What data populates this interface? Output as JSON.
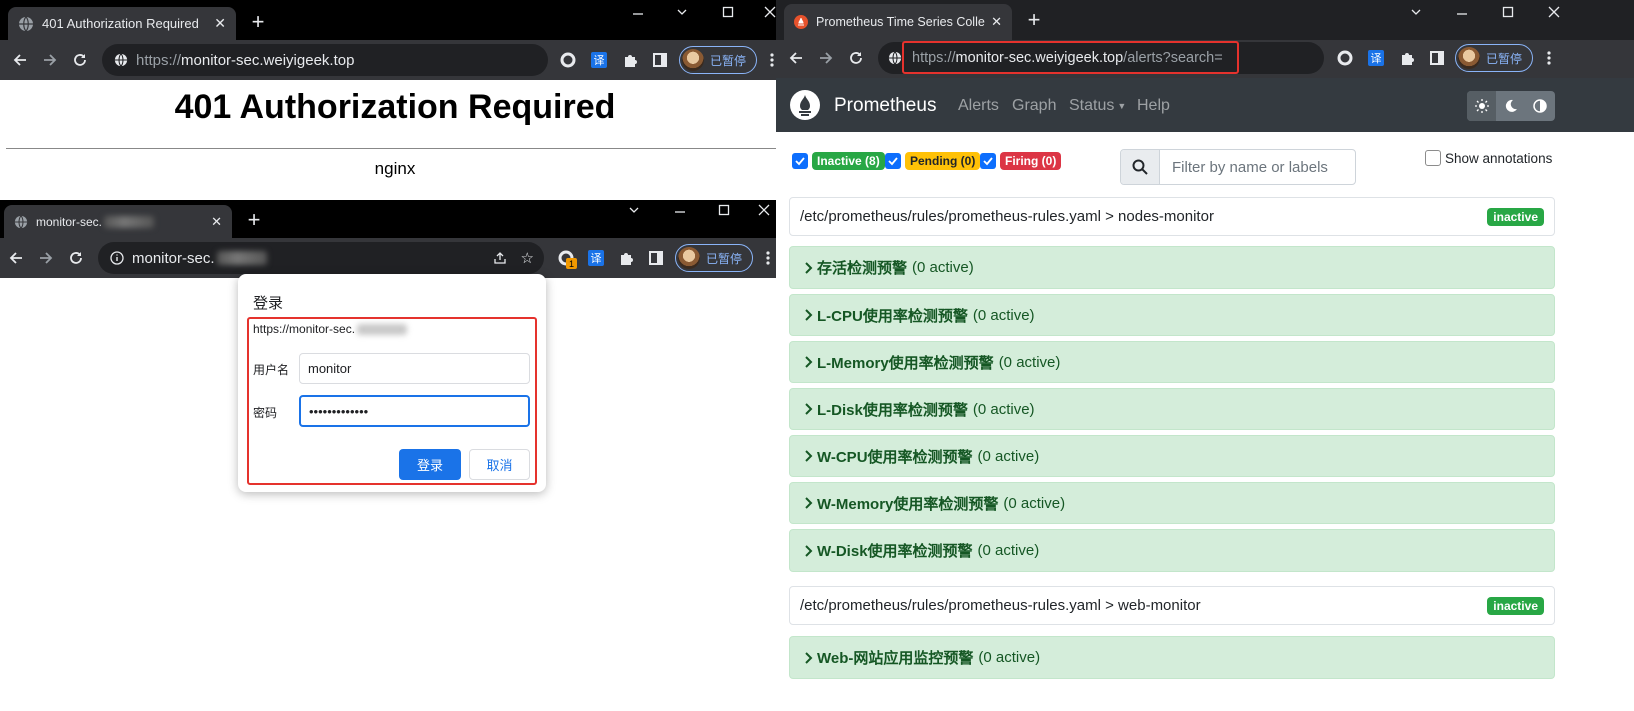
{
  "left_window": {
    "tab_title": "401 Authorization Required",
    "url_host": "monitor-sec.weiyigeek.top",
    "url_scheme": "https://",
    "paused_label": "已暂停",
    "translate_glyph": "译",
    "page": {
      "heading": "401 Authorization Required",
      "server": "nginx"
    }
  },
  "inner_window": {
    "tab_title": "monitor-sec.",
    "url_text": "monitor-sec.",
    "paused_label": "已暂停",
    "translate_glyph": "译",
    "extension_badge": "1",
    "dialog": {
      "title": "登录",
      "site": "https://monitor-sec.",
      "username_label": "用户名",
      "username_value": "monitor",
      "password_label": "密码",
      "password_value": "•••••••••••••",
      "login_button": "登录",
      "cancel_button": "取消"
    }
  },
  "right_window": {
    "tab_title": "Prometheus Time Series Colle",
    "url_scheme": "https://",
    "url_host": "monitor-sec.weiyigeek.top",
    "url_path": "/alerts?search=",
    "paused_label": "已暂停",
    "translate_glyph": "译",
    "nav": {
      "brand": "Prometheus",
      "links": [
        "Alerts",
        "Graph",
        "Status",
        "Help"
      ]
    },
    "filters": {
      "inactive": "Inactive (8)",
      "pending": "Pending (0)",
      "firing": "Firing (0)",
      "search_placeholder": "Filter by name or labels",
      "show_annotations": "Show annotations"
    },
    "groups": [
      {
        "path": "/etc/prometheus/rules/prometheus-rules.yaml > nodes-monitor",
        "state": "inactive",
        "rules": [
          {
            "name": "存活检测预警",
            "count": "(0 active)"
          },
          {
            "name": "L-CPU使用率检测预警",
            "count": "(0 active)"
          },
          {
            "name": "L-Memory使用率检测预警",
            "count": "(0 active)"
          },
          {
            "name": "L-Disk使用率检测预警",
            "count": "(0 active)"
          },
          {
            "name": "W-CPU使用率检测预警",
            "count": "(0 active)"
          },
          {
            "name": "W-Memory使用率检测预警",
            "count": "(0 active)"
          },
          {
            "name": "W-Disk使用率检测预警",
            "count": "(0 active)"
          }
        ]
      },
      {
        "path": "/etc/prometheus/rules/prometheus-rules.yaml > web-monitor",
        "state": "inactive",
        "rules": [
          {
            "name": "Web-网站应用监控预警",
            "count": "(0 active)"
          }
        ]
      }
    ]
  },
  "colors": {
    "chrome_dark": "#35363a",
    "tabstrip": "#000000",
    "highlight_red": "#e5322d",
    "prom_nav": "#343a40",
    "inactive_green": "#28a745",
    "pending_yellow": "#ffc107",
    "firing_red": "#dc3545",
    "rule_bg": "#d4edda",
    "rule_text": "#155724"
  }
}
